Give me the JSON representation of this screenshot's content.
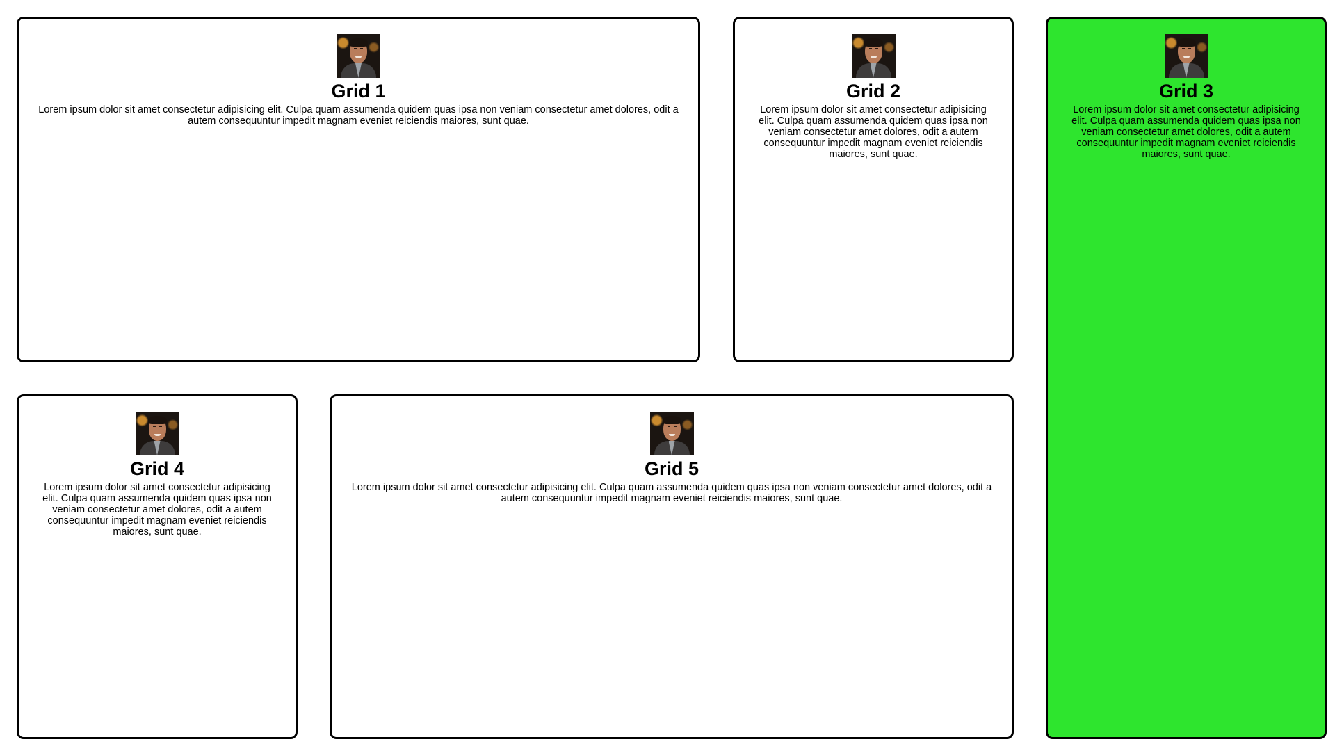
{
  "cards": [
    {
      "title": "Grid 1",
      "text": "Lorem ipsum dolor sit amet consectetur adipisicing elit. Culpa quam assumenda quidem quas ipsa non veniam consectetur amet dolores, odit a autem consequuntur impedit magnam eveniet reiciendis maiores, sunt quae.",
      "background": "#ffffff"
    },
    {
      "title": "Grid 2",
      "text": "Lorem ipsum dolor sit amet consectetur adipisicing elit. Culpa quam assumenda quidem quas ipsa non veniam consectetur amet dolores, odit a autem consequuntur impedit magnam eveniet reiciendis maiores, sunt quae.",
      "background": "#ffffff"
    },
    {
      "title": "Grid 3",
      "text": "Lorem ipsum dolor sit amet consectetur adipisicing elit. Culpa quam assumenda quidem quas ipsa non veniam consectetur amet dolores, odit a autem consequuntur impedit magnam eveniet reiciendis maiores, sunt quae.",
      "background": "#2ee52e"
    },
    {
      "title": "Grid 4",
      "text": "Lorem ipsum dolor sit amet consectetur adipisicing elit. Culpa quam assumenda quidem quas ipsa non veniam consectetur amet dolores, odit a autem consequuntur impedit magnam eveniet reiciendis maiores, sunt quae.",
      "background": "#ffffff"
    },
    {
      "title": "Grid 5",
      "text": "Lorem ipsum dolor sit amet consectetur adipisicing elit. Culpa quam assumenda quidem quas ipsa non veniam consectetur amet dolores, odit a autem consequuntur impedit magnam eveniet reiciendis maiores, sunt quae.",
      "background": "#ffffff"
    }
  ],
  "avatar_icon": "person-photo-icon",
  "colors": {
    "border": "#000000",
    "highlight": "#2ee52e"
  }
}
